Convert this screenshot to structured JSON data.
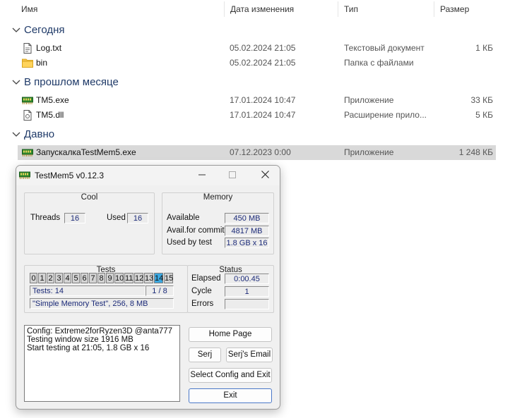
{
  "columns": {
    "name": "Имя",
    "date": "Дата изменения",
    "type": "Тип",
    "size": "Размер"
  },
  "groups": [
    {
      "name": "Сегодня",
      "rows": [
        {
          "name": "Log.txt",
          "date": "05.02.2024 21:05",
          "type": "Текстовый документ",
          "size": "1 КБ",
          "icon": "text-file-icon"
        },
        {
          "name": "bin",
          "date": "05.02.2024 21:05",
          "type": "Папка с файлами",
          "size": "",
          "icon": "folder-icon"
        }
      ]
    },
    {
      "name": "В прошлом месяце",
      "rows": [
        {
          "name": "TM5.exe",
          "date": "17.01.2024 10:47",
          "type": "Приложение",
          "size": "33 КБ",
          "icon": "memory-app-icon"
        },
        {
          "name": "TM5.dll",
          "date": "17.01.2024 10:47",
          "type": "Расширение прило...",
          "size": "5 КБ",
          "icon": "dll-file-icon"
        }
      ]
    },
    {
      "name": "Давно",
      "rows": [
        {
          "name": "ЗапускалкаTestMem5.exe",
          "date": "07.12.2023 0:00",
          "type": "Приложение",
          "size": "1 248 КБ",
          "icon": "memory-app-icon"
        }
      ]
    }
  ],
  "app": {
    "title": "TestMem5 v0.12.3",
    "cool": {
      "title": "Cool",
      "threads_label": "Threads",
      "threads": "16",
      "used_label": "Used",
      "used": "16"
    },
    "memory": {
      "title": "Memory",
      "available_label": "Available",
      "available": "450 MB",
      "commit_label": "Avail.for commit",
      "commit": "4817 MB",
      "used_label": "Used by test",
      "used": "1.8 GB x 16"
    },
    "tests": {
      "title": "Tests",
      "cells": [
        "0",
        "1",
        "2",
        "3",
        "4",
        "5",
        "6",
        "7",
        "8",
        "9",
        "10",
        "11",
        "12",
        "13",
        "14",
        "15"
      ],
      "active_index": 14,
      "count_text": "Tests: 14",
      "progress_text": "1 / 8",
      "current_test": "\"Simple Memory Test\", 256, 8 MB"
    },
    "status": {
      "title": "Status",
      "elapsed_label": "Elapsed",
      "elapsed": "0:00.45",
      "cycle_label": "Cycle",
      "cycle": "1",
      "errors_label": "Errors",
      "errors": ""
    },
    "log_lines": [
      "Config: Extreme2forRyzen3D @anta777",
      "Testing window size 1916 MB",
      "Start testing at 21:05, 1.8 GB x 16"
    ],
    "buttons": {
      "home": "Home Page",
      "serj": "Serj",
      "serj_email": "Serj's Email",
      "select_config": "Select Config and Exit",
      "exit": "Exit"
    }
  }
}
